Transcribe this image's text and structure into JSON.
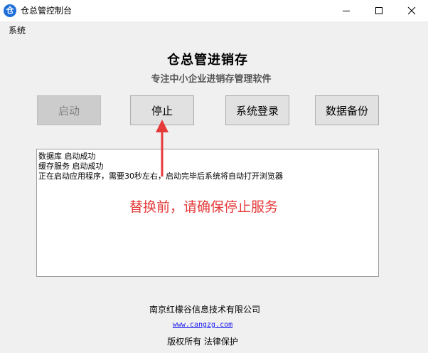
{
  "window": {
    "title": "仓总管控制台",
    "icon": "app-logo-icon",
    "icon_glyph": "仓",
    "controls": [
      "minimize-icon",
      "maximize-icon",
      "close-icon"
    ]
  },
  "menu": {
    "items": [
      {
        "label": "系统"
      }
    ]
  },
  "header": {
    "title": "仓总管进销存",
    "subtitle": "专注中小企业进销存管理软件"
  },
  "buttons": [
    {
      "label": "启动",
      "enabled": false
    },
    {
      "label": "停止",
      "enabled": true
    },
    {
      "label": "系统登录",
      "enabled": true
    },
    {
      "label": "数据备份",
      "enabled": true
    }
  ],
  "log": {
    "lines": [
      "数据库 启动成功",
      "缓存服务 启动成功",
      "正在启动应用程序，需要30秒左右，启动完毕后系统将自动打开浏览器"
    ]
  },
  "annotation": {
    "text": "替换前，请确保停止服务",
    "color": "#e53a3a"
  },
  "footer": {
    "company": "南京红檬谷信息技术有限公司",
    "website": "www.cangzg.com",
    "copyright": "版权所有 法律保护"
  }
}
